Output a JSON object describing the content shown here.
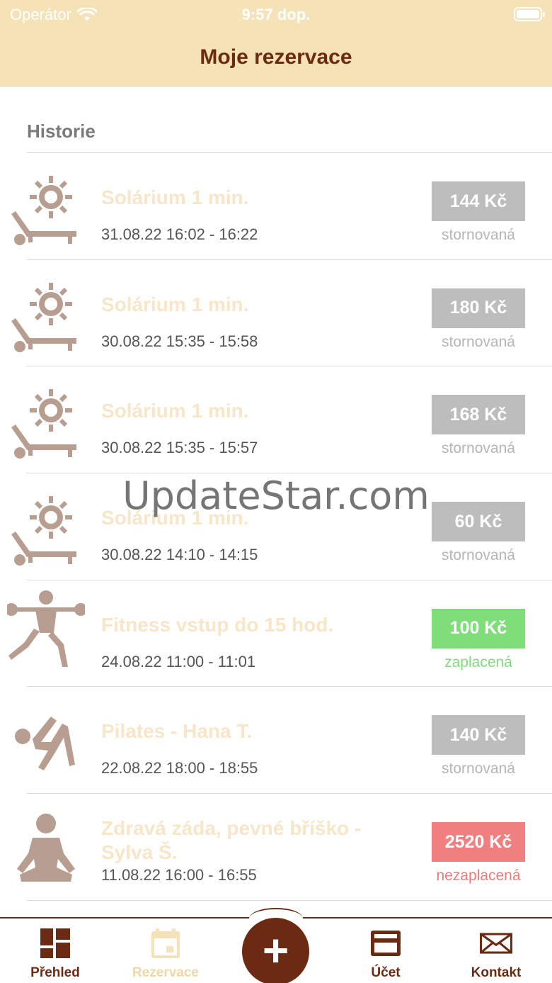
{
  "status_bar": {
    "carrier": "Operátor",
    "time": "9:57 dop."
  },
  "nav": {
    "title": "Moje rezervace"
  },
  "section": {
    "title": "Historie"
  },
  "colors": {
    "accent": "#6b2a12",
    "header_bg": "#f6e2b7",
    "icon_color": "#b79e90",
    "status_cancelled": "#bdbdbd",
    "status_paid": "#7fdd7a",
    "status_unpaid": "#f08080"
  },
  "reservations": [
    {
      "icon": "solarium-icon",
      "title": "Solárium 1 min.",
      "time": "31.08.22 16:02 - 16:22",
      "price": "144 Kč",
      "status": "stornovaná",
      "status_type": "cancelled"
    },
    {
      "icon": "solarium-icon",
      "title": "Solárium 1 min.",
      "time": "30.08.22 15:35 - 15:58",
      "price": "180 Kč",
      "status": "stornovaná",
      "status_type": "cancelled"
    },
    {
      "icon": "solarium-icon",
      "title": "Solárium 1 min.",
      "time": "30.08.22 15:35 - 15:57",
      "price": "168 Kč",
      "status": "stornovaná",
      "status_type": "cancelled"
    },
    {
      "icon": "solarium-icon",
      "title": "Solárium 1 min.",
      "time": "30.08.22 14:10 - 14:15",
      "price": "60 Kč",
      "status": "stornovaná",
      "status_type": "cancelled"
    },
    {
      "icon": "fitness-icon",
      "title": "Fitness vstup do 15 hod.",
      "time": "24.08.22 11:00 - 11:01",
      "price": "100 Kč",
      "status": "zaplacená",
      "status_type": "paid"
    },
    {
      "icon": "pilates-icon",
      "title": "Pilates - Hana T.",
      "time": "22.08.22 18:00 - 18:55",
      "price": "140 Kč",
      "status": "stornovaná",
      "status_type": "cancelled"
    },
    {
      "icon": "yoga-icon",
      "title": "Zdravá záda, pevné bříško - Sylva Š.",
      "time": "11.08.22 16:00 - 16:55",
      "price": "2520 Kč",
      "status": "nezaplacená",
      "status_type": "unpaid"
    }
  ],
  "watermark": "UpdateStar.com",
  "tabs": [
    {
      "label": "Přehled",
      "icon": "dashboard-icon",
      "active": true
    },
    {
      "label": "Rezervace",
      "icon": "calendar-icon",
      "active": false
    },
    {
      "label": "Účet",
      "icon": "card-icon",
      "active": true
    },
    {
      "label": "Kontakt",
      "icon": "envelope-icon",
      "active": true
    }
  ],
  "add_button": {
    "icon": "plus-icon",
    "label": "+"
  }
}
